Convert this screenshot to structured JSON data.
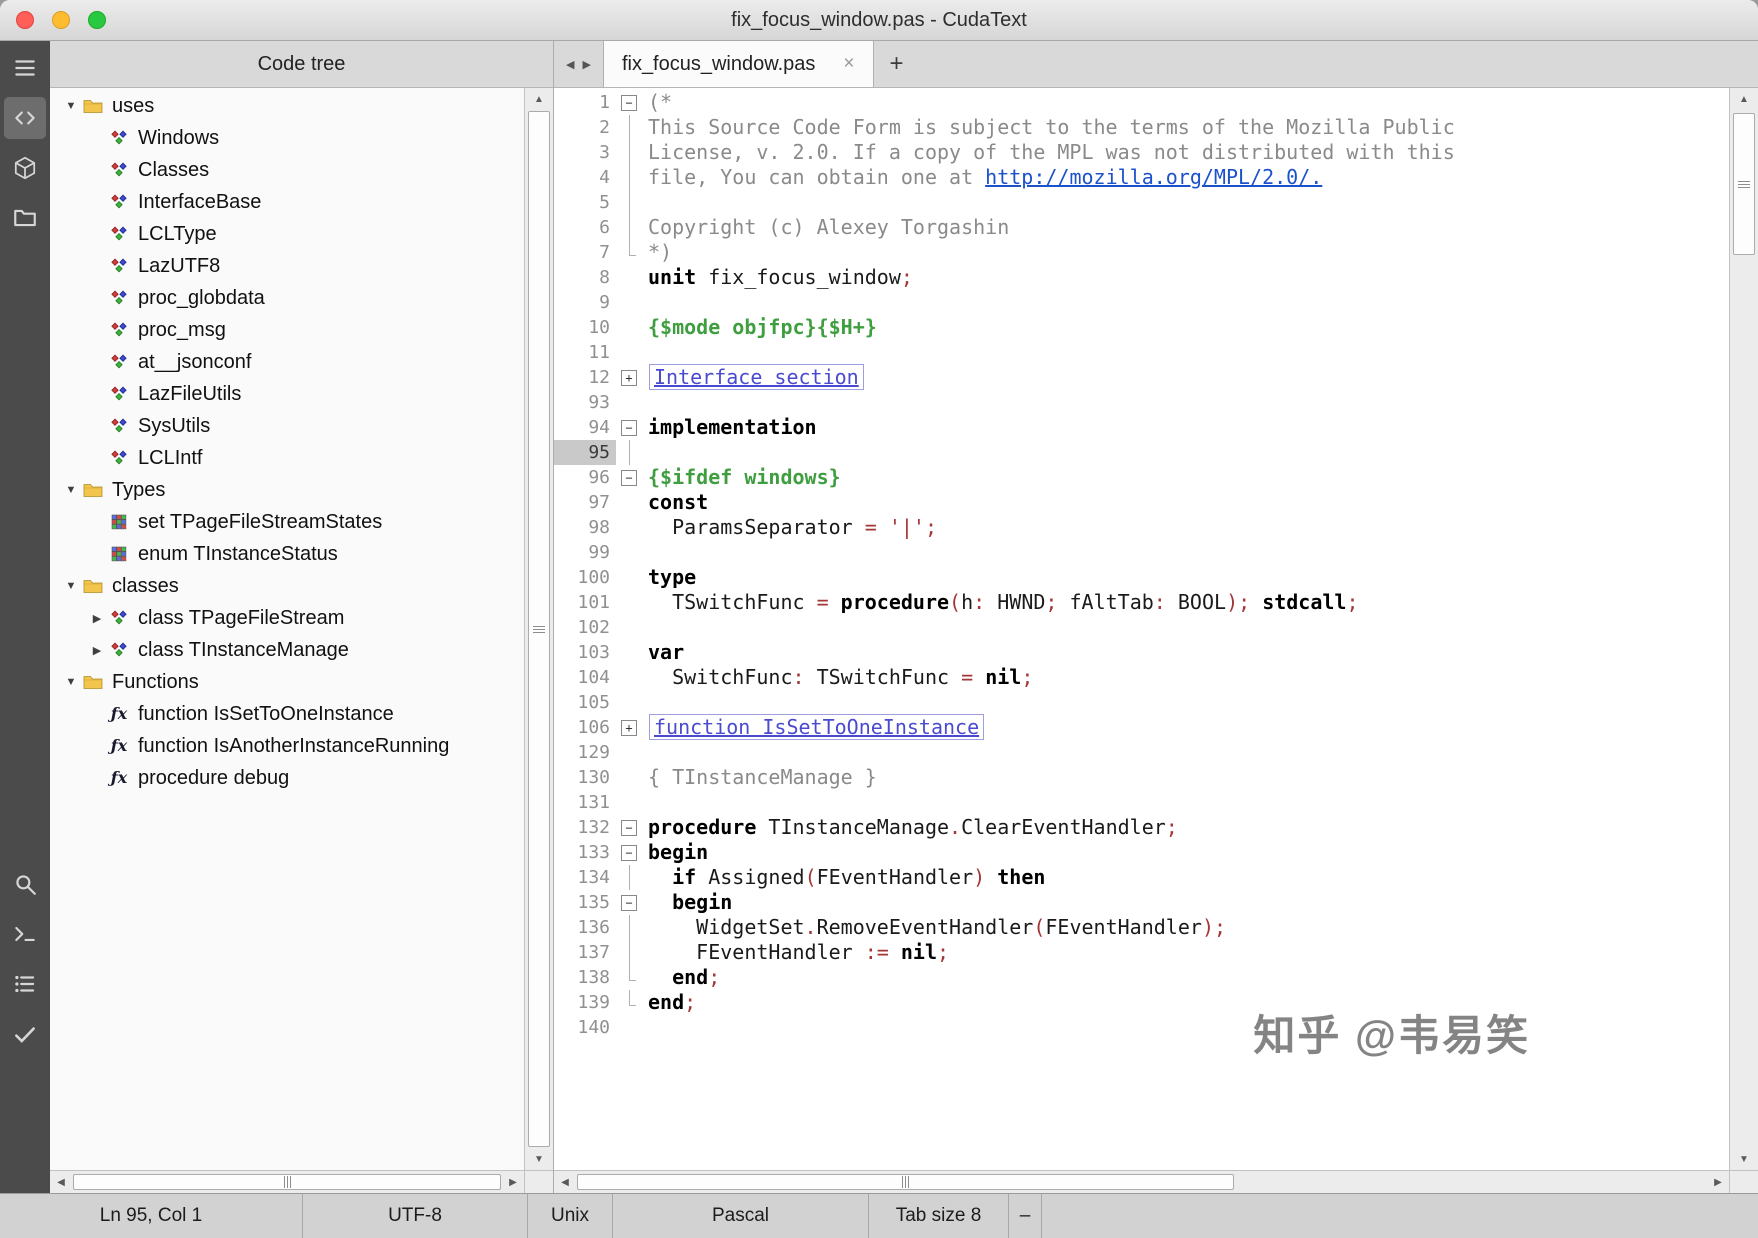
{
  "window": {
    "title": "fix_focus_window.pas - CudaText"
  },
  "activity_bar": {
    "top": [
      {
        "name": "menu-icon"
      },
      {
        "name": "code-icon",
        "active": true
      },
      {
        "name": "package-icon"
      },
      {
        "name": "folder-icon"
      }
    ],
    "bottom": [
      {
        "name": "search-icon"
      },
      {
        "name": "terminal-icon"
      },
      {
        "name": "list-icon"
      },
      {
        "name": "check-icon"
      }
    ]
  },
  "code_tree": {
    "header": "Code tree",
    "items": [
      {
        "label": "uses",
        "icon": "folder",
        "depth": 0,
        "expander": "open"
      },
      {
        "label": "Windows",
        "icon": "unit",
        "depth": 1
      },
      {
        "label": "Classes",
        "icon": "unit",
        "depth": 1
      },
      {
        "label": "InterfaceBase",
        "icon": "unit",
        "depth": 1
      },
      {
        "label": "LCLType",
        "icon": "unit",
        "depth": 1
      },
      {
        "label": "LazUTF8",
        "icon": "unit",
        "depth": 1
      },
      {
        "label": "proc_globdata",
        "icon": "unit",
        "depth": 1
      },
      {
        "label": "proc_msg",
        "icon": "unit",
        "depth": 1
      },
      {
        "label": "at__jsonconf",
        "icon": "unit",
        "depth": 1
      },
      {
        "label": "LazFileUtils",
        "icon": "unit",
        "depth": 1
      },
      {
        "label": "SysUtils",
        "icon": "unit",
        "depth": 1
      },
      {
        "label": "LCLIntf",
        "icon": "unit",
        "depth": 1
      },
      {
        "label": "Types",
        "icon": "folder",
        "depth": 0,
        "expander": "open"
      },
      {
        "label": "set TPageFileStreamStates",
        "icon": "grid",
        "depth": 1
      },
      {
        "label": "enum TInstanceStatus",
        "icon": "grid",
        "depth": 1
      },
      {
        "label": "classes",
        "icon": "folder",
        "depth": 0,
        "expander": "open"
      },
      {
        "label": "class TPageFileStream",
        "icon": "unit",
        "depth": 1,
        "expander": "closed"
      },
      {
        "label": "class TInstanceManage",
        "icon": "unit",
        "depth": 1,
        "expander": "closed"
      },
      {
        "label": "Functions",
        "icon": "folder",
        "depth": 0,
        "expander": "open"
      },
      {
        "label": "function IsSetToOneInstance",
        "icon": "func",
        "depth": 1
      },
      {
        "label": "function IsAnotherInstanceRunning",
        "icon": "func",
        "depth": 1
      },
      {
        "label": "procedure debug",
        "icon": "func",
        "depth": 1
      }
    ]
  },
  "tabs": {
    "active_label": "fix_focus_window.pas",
    "close_glyph": "×",
    "new_glyph": "+"
  },
  "editor": {
    "lines": [
      {
        "n": "1",
        "fold": "minus",
        "seg": [
          [
            "(*",
            "cmt"
          ]
        ]
      },
      {
        "n": "2",
        "fold": "line",
        "seg": [
          [
            "This Source Code Form is subject to the terms of the Mozilla Public",
            "cmt"
          ]
        ]
      },
      {
        "n": "3",
        "fold": "line",
        "seg": [
          [
            "License, v. 2.0. If a copy of the MPL was not distributed with this",
            "cmt"
          ]
        ]
      },
      {
        "n": "4",
        "fold": "line",
        "seg": [
          [
            "file, You can obtain one at ",
            "cmt"
          ],
          [
            "http://mozilla.org/MPL/2.0/.",
            "link"
          ]
        ]
      },
      {
        "n": "5",
        "fold": "line",
        "seg": []
      },
      {
        "n": "6",
        "fold": "line",
        "seg": [
          [
            "Copyright (c) Alexey Torgashin",
            "cmt"
          ]
        ]
      },
      {
        "n": "7",
        "fold": "end",
        "seg": [
          [
            "*)",
            "cmt"
          ]
        ]
      },
      {
        "n": "8",
        "fold": "",
        "seg": [
          [
            "unit",
            "kw"
          ],
          [
            " fix_focus_window",
            "txt"
          ],
          [
            ";",
            "pun"
          ]
        ]
      },
      {
        "n": "9",
        "fold": "",
        "seg": []
      },
      {
        "n": "10",
        "fold": "",
        "seg": [
          [
            "{$mode objfpc}{$H+}",
            "dir"
          ]
        ]
      },
      {
        "n": "11",
        "fold": "",
        "seg": []
      },
      {
        "n": "12",
        "fold": "plus",
        "seg": [
          [
            "Interface section",
            "fold"
          ]
        ]
      },
      {
        "n": "93",
        "fold": "",
        "seg": []
      },
      {
        "n": "94",
        "fold": "minus",
        "seg": [
          [
            "implementation",
            "kw"
          ]
        ]
      },
      {
        "n": "95",
        "fold": "line",
        "cur": true,
        "seg": []
      },
      {
        "n": "96",
        "fold": "minus",
        "seg": [
          [
            "{$ifdef windows}",
            "dir"
          ]
        ]
      },
      {
        "n": "97",
        "fold": "",
        "seg": [
          [
            "const",
            "kw"
          ]
        ]
      },
      {
        "n": "98",
        "fold": "",
        "seg": [
          [
            "  ParamsSeparator ",
            "txt"
          ],
          [
            "= ",
            "pun"
          ],
          [
            "'|'",
            "str"
          ],
          [
            ";",
            "pun"
          ]
        ]
      },
      {
        "n": "99",
        "fold": "",
        "seg": []
      },
      {
        "n": "100",
        "fold": "",
        "seg": [
          [
            "type",
            "kw"
          ]
        ]
      },
      {
        "n": "101",
        "fold": "",
        "seg": [
          [
            "  TSwitchFunc ",
            "txt"
          ],
          [
            "= ",
            "pun"
          ],
          [
            "procedure",
            "kw"
          ],
          [
            "(",
            "pun"
          ],
          [
            "h",
            "txt"
          ],
          [
            ": ",
            "pun"
          ],
          [
            "HWND",
            "txt"
          ],
          [
            "; ",
            "pun"
          ],
          [
            "fAltTab",
            "txt"
          ],
          [
            ": ",
            "pun"
          ],
          [
            "BOOL",
            "txt"
          ],
          [
            "); ",
            "pun"
          ],
          [
            "stdcall",
            "kw"
          ],
          [
            ";",
            "pun"
          ]
        ]
      },
      {
        "n": "102",
        "fold": "",
        "seg": []
      },
      {
        "n": "103",
        "fold": "",
        "seg": [
          [
            "var",
            "kw"
          ]
        ]
      },
      {
        "n": "104",
        "fold": "",
        "seg": [
          [
            "  SwitchFunc",
            "txt"
          ],
          [
            ": ",
            "pun"
          ],
          [
            "TSwitchFunc ",
            "txt"
          ],
          [
            "= ",
            "pun"
          ],
          [
            "nil",
            "kw"
          ],
          [
            ";",
            "pun"
          ]
        ]
      },
      {
        "n": "105",
        "fold": "",
        "seg": []
      },
      {
        "n": "106",
        "fold": "plus",
        "seg": [
          [
            "function IsSetToOneInstance",
            "fold"
          ]
        ]
      },
      {
        "n": "129",
        "fold": "",
        "seg": []
      },
      {
        "n": "130",
        "fold": "",
        "seg": [
          [
            "{ TInstanceManage }",
            "cmt"
          ]
        ]
      },
      {
        "n": "131",
        "fold": "",
        "seg": []
      },
      {
        "n": "132",
        "fold": "minus",
        "seg": [
          [
            "procedure",
            "kw"
          ],
          [
            " TInstanceManage",
            "txt"
          ],
          [
            ".",
            "pun"
          ],
          [
            "ClearEventHandler",
            "txt"
          ],
          [
            ";",
            "pun"
          ]
        ]
      },
      {
        "n": "133",
        "fold": "minus",
        "seg": [
          [
            "begin",
            "kw"
          ]
        ]
      },
      {
        "n": "134",
        "fold": "line",
        "seg": [
          [
            "  ",
            "txt"
          ],
          [
            "if",
            "kw"
          ],
          [
            " Assigned",
            "txt"
          ],
          [
            "(",
            "pun"
          ],
          [
            "FEventHandler",
            "txt"
          ],
          [
            ") ",
            "pun"
          ],
          [
            "then",
            "kw"
          ]
        ]
      },
      {
        "n": "135",
        "fold": "minus",
        "seg": [
          [
            "  ",
            "txt"
          ],
          [
            "begin",
            "kw"
          ]
        ]
      },
      {
        "n": "136",
        "fold": "line",
        "seg": [
          [
            "    WidgetSet",
            "txt"
          ],
          [
            ".",
            "pun"
          ],
          [
            "RemoveEventHandler",
            "txt"
          ],
          [
            "(",
            "pun"
          ],
          [
            "FEventHandler",
            "txt"
          ],
          [
            ");",
            "pun"
          ]
        ]
      },
      {
        "n": "137",
        "fold": "line",
        "seg": [
          [
            "    FEventHandler ",
            "txt"
          ],
          [
            ":= ",
            "pun"
          ],
          [
            "nil",
            "kw"
          ],
          [
            ";",
            "pun"
          ]
        ]
      },
      {
        "n": "138",
        "fold": "end",
        "seg": [
          [
            "  ",
            "txt"
          ],
          [
            "end",
            "kw"
          ],
          [
            ";",
            "pun"
          ]
        ]
      },
      {
        "n": "139",
        "fold": "end",
        "seg": [
          [
            "end",
            "kw"
          ],
          [
            ";",
            "pun"
          ]
        ]
      },
      {
        "n": "140",
        "fold": "",
        "seg": []
      }
    ]
  },
  "status_bar": {
    "cells": [
      {
        "name": "caret",
        "text": "Ln 95, Col 1"
      },
      {
        "name": "encoding",
        "text": "UTF-8"
      },
      {
        "name": "line-ends",
        "text": "Unix"
      },
      {
        "name": "lexer",
        "text": "Pascal"
      },
      {
        "name": "tab-size",
        "text": "Tab size 8"
      },
      {
        "name": "wrap",
        "text": "–"
      },
      {
        "name": "message",
        "text": ""
      }
    ]
  },
  "watermark": {
    "text": "知乎 @韦易笑"
  }
}
